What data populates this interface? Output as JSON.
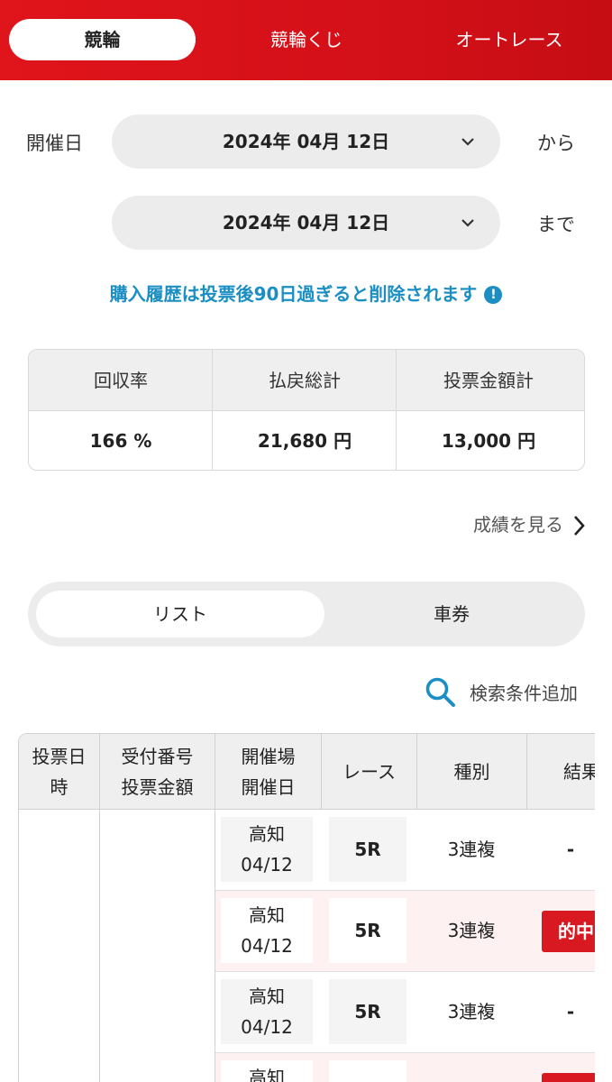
{
  "tabs": [
    "競輪",
    "競輪くじ",
    "オートレース"
  ],
  "date_filter": {
    "label": "開催日",
    "from_value": "2024年 04月 12日",
    "from_suffix": "から",
    "to_value": "2024年 04月 12日",
    "to_suffix": "まで"
  },
  "notice": "購入履歴は投票後90日過ぎると削除されます",
  "summary": {
    "headers": [
      "回収率",
      "払戻総計",
      "投票金額計"
    ],
    "values": [
      "166 %",
      "21,680 円",
      "13,000 円"
    ]
  },
  "see_results": "成績を見る",
  "view_toggle": {
    "list": "リスト",
    "ticket": "車券"
  },
  "search_label": "検索条件追加",
  "table": {
    "headers": {
      "col1_l1": "投票日",
      "col1_l2": "時",
      "col2_l1": "受付番号",
      "col2_l2": "投票金額",
      "col3_l1": "開催場",
      "col3_l2": "開催日",
      "col4": "レース",
      "col5": "種別",
      "col6": "結果"
    },
    "rows": [
      {
        "venue": "高知",
        "date": "04/12",
        "race": "5R",
        "type": "3連複",
        "result": "-"
      },
      {
        "venue": "高知",
        "date": "04/12",
        "race": "5R",
        "type": "3連複",
        "result": "的中"
      },
      {
        "venue": "高知",
        "date": "04/12",
        "race": "5R",
        "type": "3連複",
        "result": "-"
      },
      {
        "venue": "高知",
        "date": "",
        "race": "",
        "type": "",
        "result": ""
      }
    ]
  },
  "colors": {
    "brand_red": "#d41018",
    "accent_blue": "#1b8fc4",
    "hit_red": "#d81921"
  }
}
